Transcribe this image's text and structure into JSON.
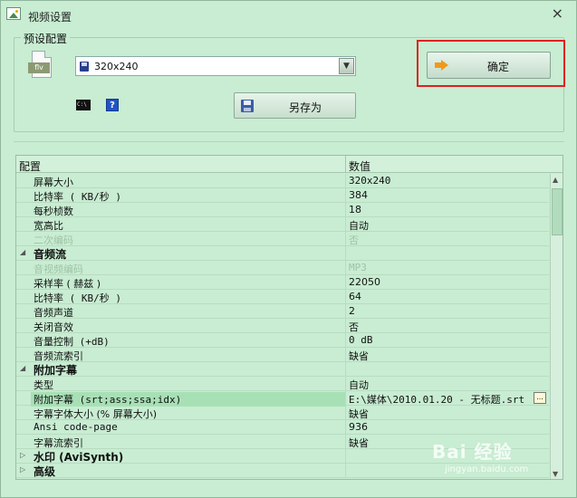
{
  "window": {
    "title": "视频设置",
    "close_glyph": "×"
  },
  "preset": {
    "group_label": "预设配置",
    "file_tag": "flv",
    "selected": "320x240",
    "cmd_label": "C:\\",
    "help_label": "?",
    "save_as_label": "另存为",
    "confirm_label": "确定"
  },
  "grid": {
    "header_name": "配置",
    "header_value": "数值",
    "rows": [
      {
        "name": "屏幕大小",
        "value": "320x240",
        "kind": "prop"
      },
      {
        "name": "比特率 ( KB/秒 )",
        "value": "384",
        "kind": "prop"
      },
      {
        "name": "每秒桢数",
        "value": "18",
        "kind": "prop"
      },
      {
        "name": "宽高比",
        "value": "自动",
        "kind": "prop"
      },
      {
        "name": "二次编码",
        "value": "否",
        "kind": "disabled"
      },
      {
        "name": "音频流",
        "value": "",
        "kind": "category",
        "toggle": "◢"
      },
      {
        "name": "音视频编码",
        "value": "MP3",
        "kind": "disabled"
      },
      {
        "name": "采样率 ( 赫兹 )",
        "value": "22050",
        "kind": "prop"
      },
      {
        "name": "比特率 ( KB/秒 )",
        "value": "64",
        "kind": "prop"
      },
      {
        "name": "音频声道",
        "value": "2",
        "kind": "prop"
      },
      {
        "name": "关闭音效",
        "value": "否",
        "kind": "prop"
      },
      {
        "name": "音量控制 (+dB)",
        "value": "0 dB",
        "kind": "prop"
      },
      {
        "name": "音频流索引",
        "value": "缺省",
        "kind": "prop"
      },
      {
        "name": "附加字幕",
        "value": "",
        "kind": "category",
        "toggle": "◢"
      },
      {
        "name": "类型",
        "value": "自动",
        "kind": "prop"
      },
      {
        "name": "附加字幕 (srt;ass;ssa;idx)",
        "value": "E:\\媒体\\2010.01.20 - 无标题.srt",
        "kind": "selected",
        "ellipsis": "..."
      },
      {
        "name": "字幕字体大小 (% 屏幕大小)",
        "value": "缺省",
        "kind": "prop"
      },
      {
        "name": "Ansi code-page",
        "value": "936",
        "kind": "prop"
      },
      {
        "name": "字幕流索引",
        "value": "缺省",
        "kind": "prop"
      },
      {
        "name": "水印 (AviSynth)",
        "value": "",
        "kind": "category",
        "toggle": "▷"
      },
      {
        "name": "高级",
        "value": "",
        "kind": "category",
        "toggle": "▷"
      }
    ],
    "scroll_up": "▲",
    "scroll_down": "▼"
  },
  "watermark": {
    "brand": "Bai 经验",
    "url": "jingyan.baidu.com"
  }
}
